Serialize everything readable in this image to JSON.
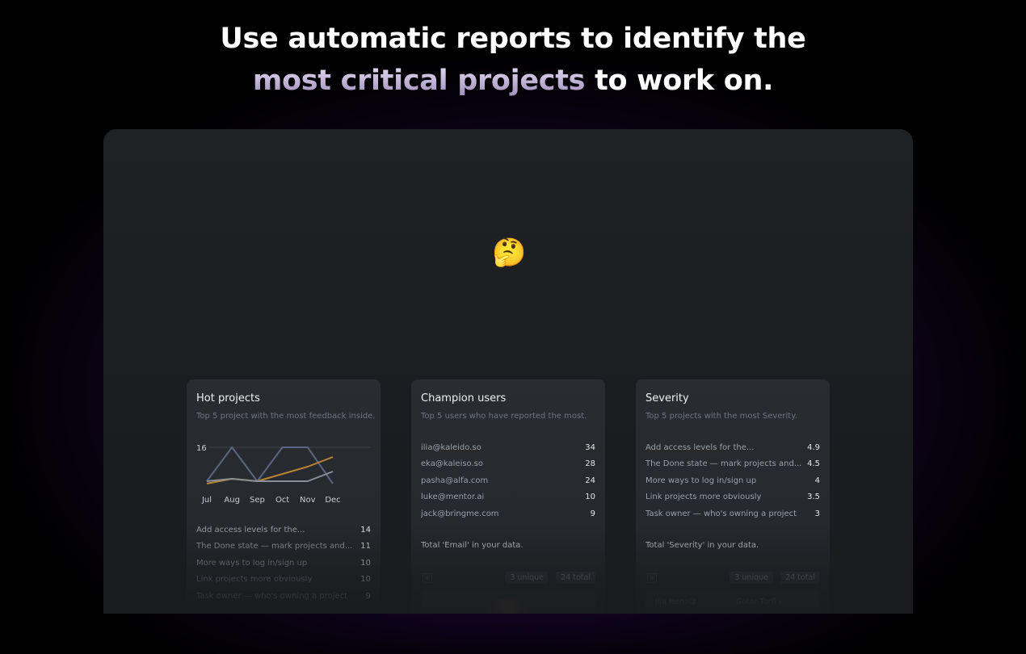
{
  "headline": {
    "line1": "Use automatic reports to identify the",
    "accent": "most critical projects",
    "rest": " to work on."
  },
  "emoji": "🤔",
  "cards": {
    "hot": {
      "title": "Hot projects",
      "subtitle": "Top 5 project with the most feedback inside.",
      "items": [
        {
          "label": "Add access levels for the...",
          "value": "14"
        },
        {
          "label": "The Done state — mark projects and...",
          "value": "11"
        },
        {
          "label": "More ways to log in/sign up",
          "value": "10"
        },
        {
          "label": "Link projects more obviously",
          "value": "10"
        },
        {
          "label": "Task owner — who's owning a project",
          "value": "9"
        }
      ]
    },
    "champion": {
      "title": "Champion users",
      "subtitle": "Top 5 users who have reported the most.",
      "items": [
        {
          "label": "ilia@kaleido.so",
          "value": "34"
        },
        {
          "label": "eka@kaleiso.so",
          "value": "28"
        },
        {
          "label": "pasha@alfa.com",
          "value": "24"
        },
        {
          "label": "luke@mentor.ai",
          "value": "10"
        },
        {
          "label": "jack@bringme.com",
          "value": "9"
        }
      ],
      "total": "Total 'Email' in your data.",
      "unique": "3 unique",
      "count": "24 total"
    },
    "severity": {
      "title": "Severity",
      "subtitle": "Top 5 projects with the most Severity.",
      "items": [
        {
          "label": "Add access levels for the...",
          "value": "4.9"
        },
        {
          "label": "The Done state — mark projects and...",
          "value": "4.5"
        },
        {
          "label": "More ways to log in/sign up",
          "value": "4"
        },
        {
          "label": "Link projects more obviously",
          "value": "3.5"
        },
        {
          "label": "Task owner — who's owning a project",
          "value": "3"
        }
      ],
      "total": "Total 'Severity' in your data.",
      "unique": "3 unique",
      "count": "24 total",
      "field_left": "Ilia Henotz ·",
      "field_right": "Gotar Torfl ›"
    }
  },
  "chart_data": {
    "type": "line",
    "categories": [
      "Jul",
      "Aug",
      "Sep",
      "Oct",
      "Nov",
      "Dec"
    ],
    "ytick": "16",
    "series": [
      {
        "values": [
          2,
          16,
          2,
          16,
          16,
          1
        ],
        "color": "#596584"
      },
      {
        "values": [
          1,
          3,
          2,
          5,
          8,
          12
        ],
        "color": "#b98336"
      },
      {
        "values": [
          2,
          3,
          2,
          2,
          2,
          6
        ],
        "color": "#8b9097"
      }
    ],
    "ylim": [
      0,
      16
    ]
  }
}
